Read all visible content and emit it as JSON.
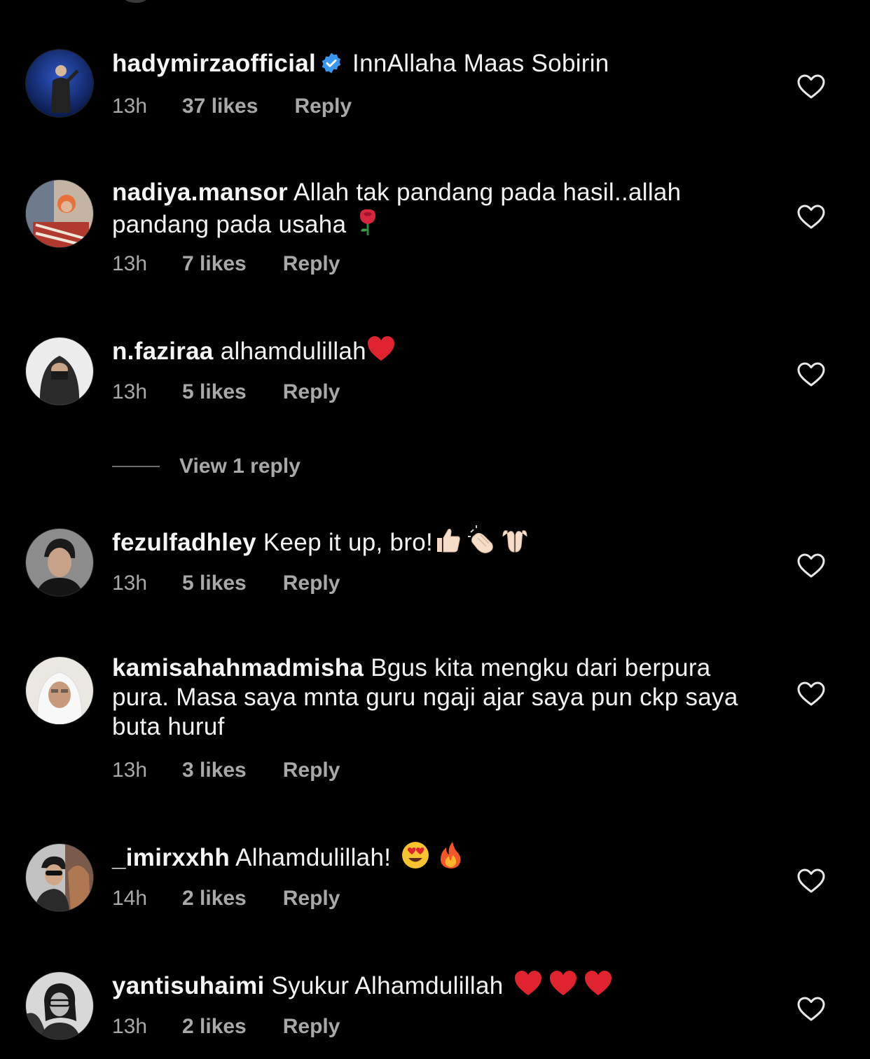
{
  "comments": [
    {
      "username": "hadymirzaofficial",
      "verified": true,
      "text": "InnAllaha Maas Sobirin",
      "time": "13h",
      "likes": "37 likes",
      "reply": "Reply",
      "avatar_colors": [
        "#1a3a8f",
        "#0c1f5c"
      ]
    },
    {
      "username": "nadiya.mansor",
      "text": "Allah tak pandang pada hasil..allah pandang pada usaha",
      "emoji": [
        "rose"
      ],
      "time": "13h",
      "likes": "7 likes",
      "reply": "Reply",
      "avatar_colors": [
        "#c9a48a",
        "#8a5a3c"
      ]
    },
    {
      "username": "n.faziraa",
      "text": "alhamdulillah",
      "emoji": [
        "red-heart"
      ],
      "time": "13h",
      "likes": "5 likes",
      "reply": "Reply",
      "view_replies": "View 1 reply",
      "avatar_colors": [
        "#e8e8e8",
        "#2a2a2a"
      ]
    },
    {
      "username": "fezulfadhley",
      "text": "Keep it up, bro!",
      "emoji": [
        "thumbs-up",
        "clapping-hands",
        "palms-up"
      ],
      "time": "13h",
      "likes": "5 likes",
      "reply": "Reply",
      "avatar_colors": [
        "#9a9a9a",
        "#1e1e1e"
      ]
    },
    {
      "username": "kamisahahmadmisha",
      "text": "Bgus kita mengku dari berpura pura. Masa saya mnta guru ngaji ajar saya pun ckp saya buta huruf",
      "time": "13h",
      "likes": "3 likes",
      "reply": "Reply",
      "avatar_colors": [
        "#f0ece6",
        "#b08c72"
      ]
    },
    {
      "username": "_imirxxhh",
      "text": "Alhamdulillah!",
      "emoji": [
        "heart-eyes",
        "fire"
      ],
      "time": "14h",
      "likes": "2 likes",
      "reply": "Reply",
      "avatar_colors": [
        "#b8b8b8",
        "#2c2c2c"
      ]
    },
    {
      "username": "yantisuhaimi",
      "text": "Syukur Alhamdulillah",
      "emoji": [
        "red-heart",
        "red-heart",
        "red-heart"
      ],
      "time": "13h",
      "likes": "2 likes",
      "reply": "Reply",
      "avatar_colors": [
        "#d0d0d0",
        "#1a1a1a"
      ]
    }
  ],
  "colors": {
    "background": "#000000",
    "primary_text": "#f5f5f5",
    "secondary_text": "#a8a8a8",
    "verified_badge": "#3897f0"
  }
}
